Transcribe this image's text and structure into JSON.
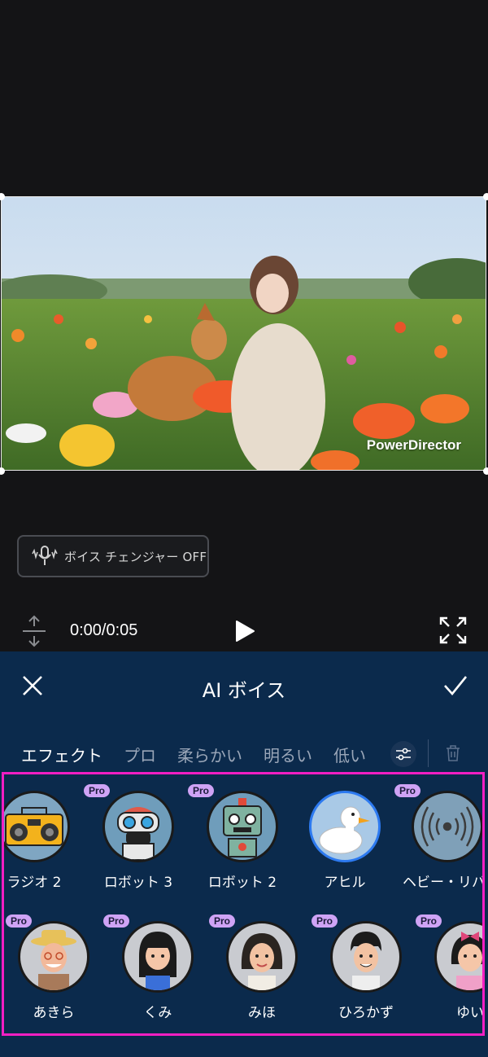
{
  "video": {
    "watermark": "PowerDirector"
  },
  "voice_changer": {
    "label": "ボイス チェンジャー OFF"
  },
  "playback": {
    "time": "0:00/0:05"
  },
  "panel": {
    "title": "AI ボイス",
    "tabs": [
      "エフェクト",
      "プロ",
      "柔らかい",
      "明るい",
      "低い"
    ],
    "active_tab": "エフェクト",
    "badge": "Pro",
    "row1": [
      {
        "name": "ラジオ 2",
        "pro": false,
        "icon": "radio-boombox"
      },
      {
        "name": "ロボット 3",
        "pro": true,
        "icon": "robot-3"
      },
      {
        "name": "ロボット 2",
        "pro": true,
        "icon": "robot-2"
      },
      {
        "name": "アヒル",
        "pro": false,
        "icon": "duck",
        "selected": true
      },
      {
        "name": "ヘビー・リバーブ",
        "pro": true,
        "icon": "reverb-waves"
      }
    ],
    "row2": [
      {
        "name": "あきら",
        "pro": true,
        "icon": "old-man"
      },
      {
        "name": "くみ",
        "pro": true,
        "icon": "girl"
      },
      {
        "name": "みほ",
        "pro": true,
        "icon": "woman"
      },
      {
        "name": "ひろかず",
        "pro": true,
        "icon": "young-man"
      },
      {
        "name": "ゆい",
        "pro": true,
        "icon": "girl-bow"
      }
    ]
  },
  "colors": {
    "panel_bg": "#0b2a4c",
    "highlight_border": "#f21fc3",
    "pro_badge": "#cfa3f5",
    "tab_indicator": "#3a6cff",
    "selected_ring": "#2d7af0"
  }
}
